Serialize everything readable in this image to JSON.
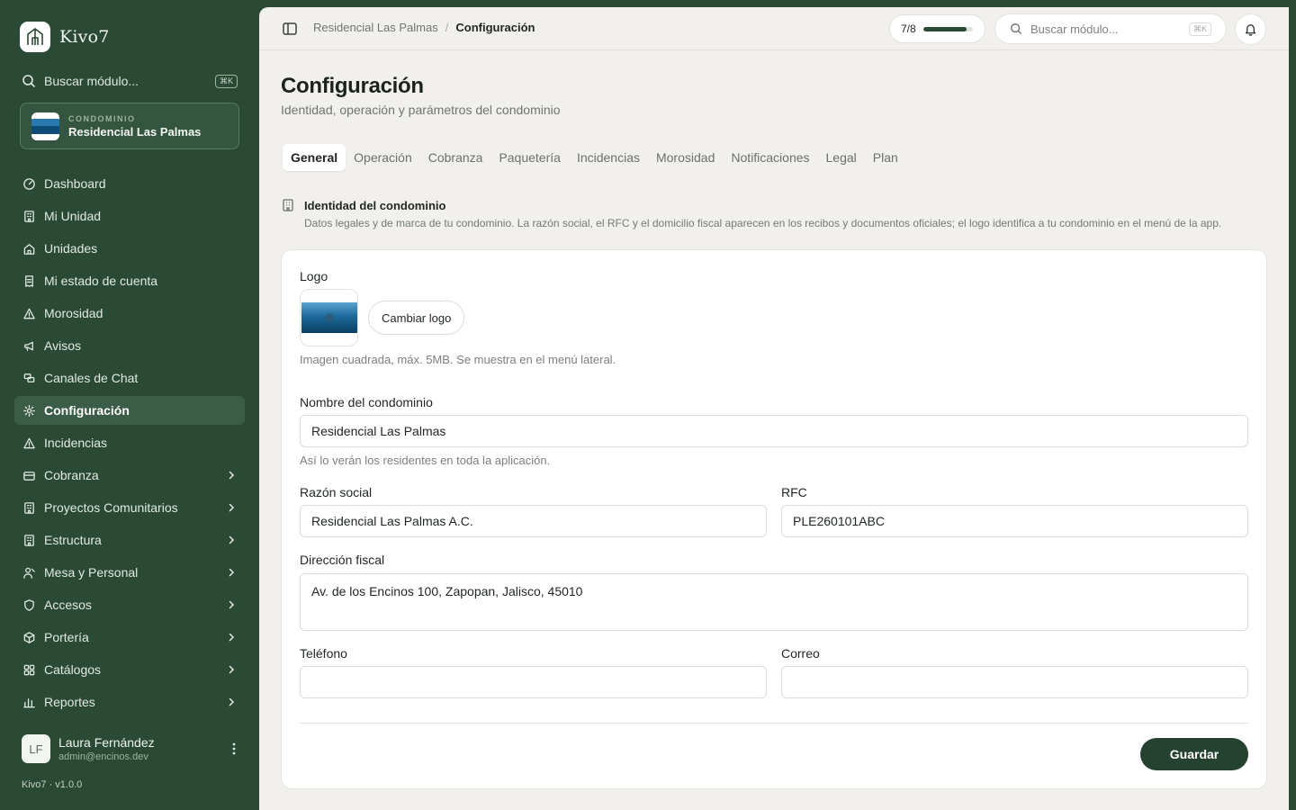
{
  "app": {
    "name": "Kivo7",
    "version": "Kivo7 · v1.0.0"
  },
  "sidebar": {
    "search": {
      "placeholder": "Buscar módulo...",
      "shortcut": "⌘K"
    },
    "condo": {
      "kicker": "CONDOMINIO",
      "name": "Residencial Las Palmas"
    },
    "items": [
      {
        "label": "Dashboard",
        "icon": "gauge-icon",
        "active": false,
        "expandable": false
      },
      {
        "label": "Mi Unidad",
        "icon": "building-icon",
        "active": false,
        "expandable": false
      },
      {
        "label": "Unidades",
        "icon": "home-icon",
        "active": false,
        "expandable": false
      },
      {
        "label": "Mi estado de cuenta",
        "icon": "receipt-icon",
        "active": false,
        "expandable": false
      },
      {
        "label": "Morosidad",
        "icon": "warning-icon",
        "active": false,
        "expandable": false
      },
      {
        "label": "Avisos",
        "icon": "megaphone-icon",
        "active": false,
        "expandable": false
      },
      {
        "label": "Canales de Chat",
        "icon": "chat-icon",
        "active": false,
        "expandable": false
      },
      {
        "label": "Configuración",
        "icon": "gear-icon",
        "active": true,
        "expandable": false
      },
      {
        "label": "Incidencias",
        "icon": "warning-icon",
        "active": false,
        "expandable": false
      },
      {
        "label": "Cobranza",
        "icon": "card-icon",
        "active": false,
        "expandable": true
      },
      {
        "label": "Proyectos Comunitarios",
        "icon": "building-icon",
        "active": false,
        "expandable": true
      },
      {
        "label": "Estructura",
        "icon": "building-icon",
        "active": false,
        "expandable": true
      },
      {
        "label": "Mesa y Personal",
        "icon": "person-icon",
        "active": false,
        "expandable": true
      },
      {
        "label": "Accesos",
        "icon": "shield-icon",
        "active": false,
        "expandable": true
      },
      {
        "label": "Portería",
        "icon": "box-icon",
        "active": false,
        "expandable": true
      },
      {
        "label": "Catálogos",
        "icon": "grid-icon",
        "active": false,
        "expandable": true
      },
      {
        "label": "Reportes",
        "icon": "bar-chart-icon",
        "active": false,
        "expandable": true
      }
    ],
    "user": {
      "initials": "LF",
      "name": "Laura Fernández",
      "email": "admin@encinos.dev"
    }
  },
  "topbar": {
    "breadcrumb": [
      "Residencial Las Palmas",
      "Configuración"
    ],
    "progress": {
      "label": "7/8",
      "value": 0.875
    },
    "search": {
      "placeholder": "Buscar módulo...",
      "shortcut": "⌘K"
    }
  },
  "page": {
    "title": "Configuración",
    "subtitle": "Identidad, operación y parámetros del condominio",
    "tabs": [
      "General",
      "Operación",
      "Cobranza",
      "Paquetería",
      "Incidencias",
      "Morosidad",
      "Notificaciones",
      "Legal",
      "Plan"
    ],
    "active_tab": "General",
    "section": {
      "title": "Identidad del condominio",
      "description": "Datos legales y de marca de tu condominio. La razón social, el RFC y el domicilio fiscal aparecen en los recibos y documentos oficiales; el logo identifica a tu condominio en el menú de la app."
    },
    "form": {
      "logo_label": "Logo",
      "change_logo": "Cambiar logo",
      "logo_hint": "Imagen cuadrada, máx. 5MB. Se muestra en el menú lateral.",
      "name_label": "Nombre del condominio",
      "name_value": "Residencial Las Palmas",
      "name_hint": "Así lo verán los residentes en toda la aplicación.",
      "razon_label": "Razón social",
      "razon_value": "Residencial Las Palmas A.C.",
      "rfc_label": "RFC",
      "rfc_value": "PLE260101ABC",
      "address_label": "Dirección fiscal",
      "address_value": "Av. de los Encinos 100, Zapopan, Jalisco, 45010",
      "phone_label": "Teléfono",
      "phone_value": "",
      "email_label": "Correo",
      "email_value": "",
      "save": "Guardar"
    }
  }
}
